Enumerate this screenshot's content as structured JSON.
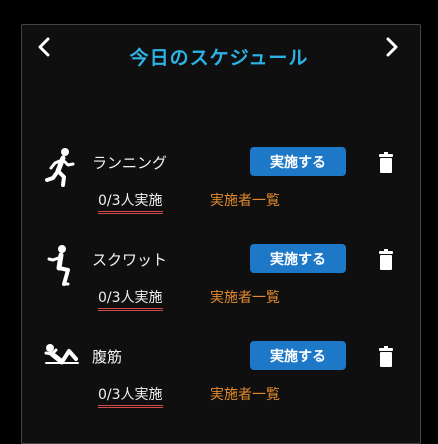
{
  "header": {
    "title": "今日のスケジュール",
    "prev_icon": "chevron-left-icon",
    "next_icon": "chevron-right-icon"
  },
  "colors": {
    "title": "#2cb3e6",
    "action_button": "#1e78c8",
    "link": "#e38a2c",
    "count_underline": "#d04a4a"
  },
  "exercises": [
    {
      "name": "ランニング",
      "icon": "running-icon",
      "action_label": "実施する",
      "count_text": "0/3人実施",
      "list_link": "実施者一覧"
    },
    {
      "name": "スクワット",
      "icon": "squat-icon",
      "action_label": "実施する",
      "count_text": "0/3人実施",
      "list_link": "実施者一覧"
    },
    {
      "name": "腹筋",
      "icon": "situp-icon",
      "action_label": "実施する",
      "count_text": "0/3人実施",
      "list_link": "実施者一覧"
    }
  ]
}
